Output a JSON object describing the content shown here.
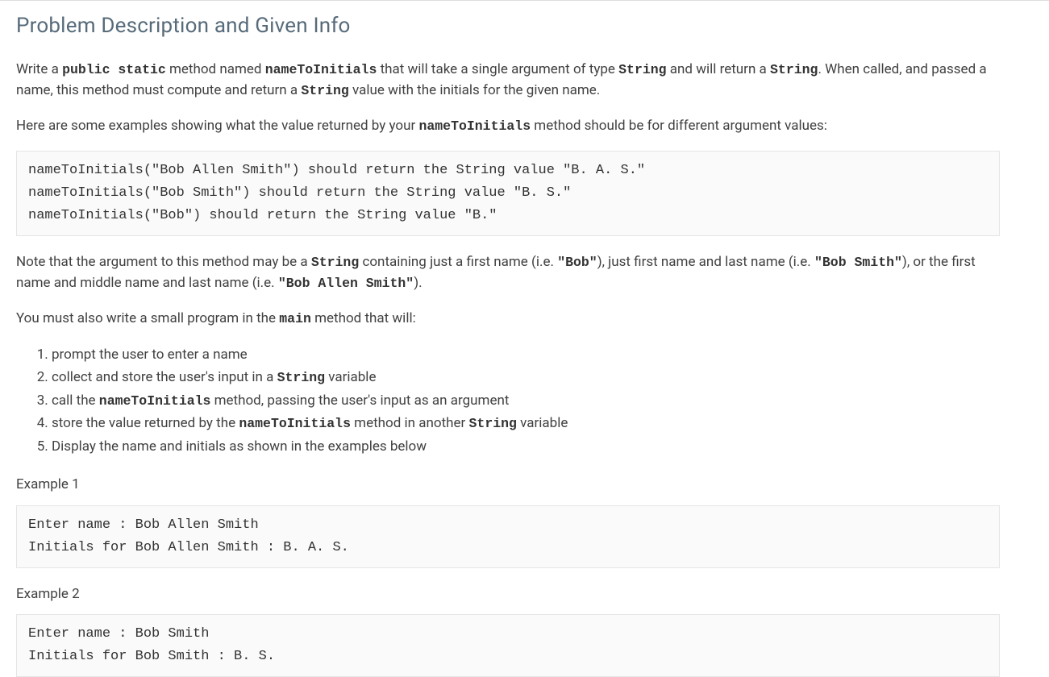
{
  "title": "Problem Description and Given Info",
  "para1": {
    "pre1": "Write a ",
    "code1": "public static",
    "mid1": " method named ",
    "code2": "nameToInitials",
    "mid2": " that will take a single argument of type ",
    "code3": "String",
    "mid3": " and will return a ",
    "code4": "String",
    "post": ". When called, and passed a name, this method must compute and return a ",
    "code5": "String",
    "tail": " value with the initials for the given name."
  },
  "para2": {
    "pre": "Here are some examples showing what the value returned by your ",
    "code": "nameToInitials",
    "post": " method should be for different argument values:"
  },
  "examples_code": "nameToInitials(\"Bob Allen Smith\") should return the String value \"B. A. S.\"\nnameToInitials(\"Bob Smith\") should return the String value \"B. S.\"\nnameToInitials(\"Bob\") should return the String value \"B.\"",
  "para3": {
    "pre": "Note that the argument to this method may be a ",
    "c1": "String",
    "m1": " containing just a first name (i.e. ",
    "c2": "\"Bob\"",
    "m2": "), just first name and last name (i.e. ",
    "c3": "\"Bob Smith\"",
    "m3": "), or the first name and middle name and last name (i.e. ",
    "c4": "\"Bob Allen Smith\"",
    "m4": ")."
  },
  "para4": {
    "pre": "You must also write a small program in the ",
    "c1": "main",
    "post": " method that will:"
  },
  "steps": {
    "s1": "prompt the user to enter a name",
    "s2_pre": "collect and store the user's input in a ",
    "s2_c": "String",
    "s2_post": " variable",
    "s3_pre": "call the ",
    "s3_c": "nameToInitials",
    "s3_post": " method, passing the user's input as an argument",
    "s4_pre": "store the value returned by the ",
    "s4_c1": "nameToInitials",
    "s4_mid": " method in another ",
    "s4_c2": "String",
    "s4_post": " variable",
    "s5": "Display the name and initials as shown in the examples below"
  },
  "example1_label": "Example 1",
  "example1_code": "Enter name : Bob Allen Smith\nInitials for Bob Allen Smith : B. A. S.",
  "example2_label": "Example 2",
  "example2_code": "Enter name : Bob Smith\nInitials for Bob Smith : B. S."
}
